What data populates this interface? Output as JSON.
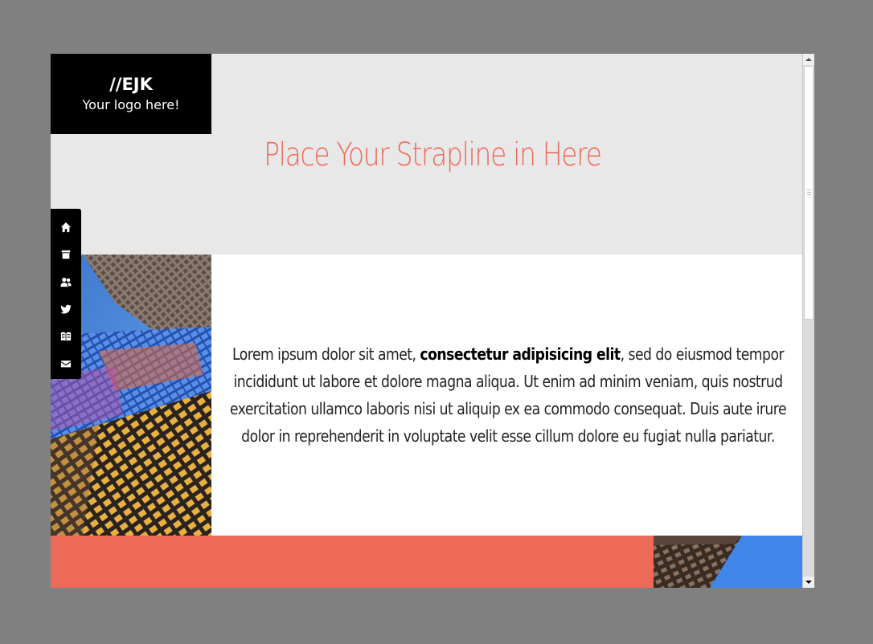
{
  "logo": {
    "mark": "//EJK",
    "tagline": "Your logo here!"
  },
  "header": {
    "strapline": "Place Your Strapline in Here",
    "strapline_color": "#ee6a58"
  },
  "nav": {
    "items": [
      {
        "icon": "home-icon"
      },
      {
        "icon": "archive-icon"
      },
      {
        "icon": "users-icon"
      },
      {
        "icon": "twitter-icon"
      },
      {
        "icon": "book-icon"
      },
      {
        "icon": "mail-icon"
      }
    ]
  },
  "content": {
    "text_before": "Lorem ipsum dolor sit amet, ",
    "text_bold": "consectetur adipisicing elit",
    "text_after": ", sed do eiusmod tempor incididunt ut labore et dolore magna aliqua. Ut enim ad minim veniam, quis nostrud exercitation ullamco laboris nisi ut aliquip ex ea commodo consequat. Duis aute irure dolor in reprehenderit in voluptate velit esse cillum dolore eu fugiat nulla pariatur."
  },
  "colors": {
    "accent": "#ee6a58",
    "header_bg": "#e8e8e8",
    "nav_bg": "#000000"
  }
}
